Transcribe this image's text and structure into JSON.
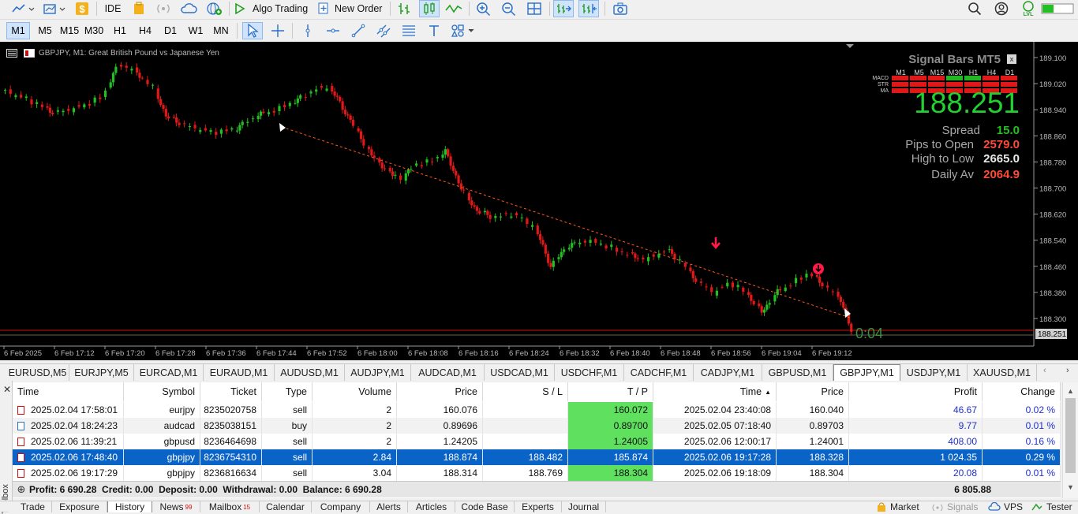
{
  "toolbar": {
    "ide": "IDE",
    "algo_trading": "Algo Trading",
    "new_order": "New Order",
    "timeframes": [
      "M1",
      "M5",
      "M15",
      "M30",
      "H1",
      "H4",
      "D1",
      "W1",
      "MN"
    ],
    "active_timeframe": "M1"
  },
  "chart": {
    "symbol_title": "GBPJPY, M1:  Great British Pound vs Japanese Yen",
    "timer": "0:04",
    "price_axis": [
      "189.100",
      "189.020",
      "188.940",
      "188.860",
      "188.780",
      "188.700",
      "188.620",
      "188.540",
      "188.460",
      "188.380",
      "188.300"
    ],
    "current_price_label": "188.251",
    "time_axis": [
      "6 Feb 2025",
      "6 Feb 17:12",
      "6 Feb 17:20",
      "6 Feb 17:28",
      "6 Feb 17:36",
      "6 Feb 17:44",
      "6 Feb 17:52",
      "6 Feb 18:00",
      "6 Feb 18:08",
      "6 Feb 18:16",
      "6 Feb 18:24",
      "6 Feb 18:32",
      "6 Feb 18:40",
      "6 Feb 18:48",
      "6 Feb 18:56",
      "6 Feb 19:04",
      "6 Feb 19:12"
    ],
    "colors": {
      "bull": "#22c022",
      "bear": "#e01818",
      "background": "#000000",
      "grid": "#1f1f1f"
    }
  },
  "signal_panel": {
    "title": "Signal Bars MT5",
    "close": "x",
    "timeframes": [
      "M1",
      "M5",
      "M15",
      "M30",
      "H1",
      "H4",
      "D1"
    ],
    "rows": [
      "MACD",
      "STR",
      "MA"
    ],
    "price": "188.251",
    "spread_label": "Spread",
    "spread_value": "15.0",
    "pips_label": "Pips to Open",
    "pips_value": "2579.0",
    "hl_label": "High to Low",
    "hl_value": "2665.0",
    "daily_label": "Daily Av",
    "daily_value": "2064.9"
  },
  "symbol_tabs": [
    "EURUSD,M5",
    "EURJPY,M5",
    "EURCAD,M1",
    "EURAUD,M1",
    "AUDUSD,M1",
    "AUDJPY,M1",
    "AUDCAD,M1",
    "USDCAD,M1",
    "USDCHF,M1",
    "CADCHF,M1",
    "CADJPY,M1",
    "GBPUSD,M1",
    "GBPJPY,M1",
    "USDJPY,M1",
    "XAUUSD,M1"
  ],
  "active_symbol_tab": "GBPJPY,M1",
  "history": {
    "columns": [
      "Time",
      "Symbol",
      "Ticket",
      "Type",
      "Volume",
      "Price",
      "S / L",
      "T / P",
      "Time",
      "Price",
      "Profit",
      "Change"
    ],
    "rows": [
      {
        "time": "2025.02.04 17:58:01",
        "symbol": "eurjpy",
        "ticket": "8235020758",
        "type": "sell",
        "volume": "2",
        "price": "160.076",
        "sl": "",
        "tp": "160.072",
        "time2": "2025.02.04 23:40:08",
        "price2": "160.040",
        "profit": "46.67",
        "change": "0.02 %"
      },
      {
        "time": "2025.02.04 18:24:23",
        "symbol": "audcad",
        "ticket": "8235038151",
        "type": "buy",
        "volume": "2",
        "price": "0.89696",
        "sl": "",
        "tp": "0.89700",
        "time2": "2025.02.05 07:18:40",
        "price2": "0.89703",
        "profit": "9.77",
        "change": "0.01 %"
      },
      {
        "time": "2025.02.06 11:39:21",
        "symbol": "gbpusd",
        "ticket": "8236464698",
        "type": "sell",
        "volume": "2",
        "price": "1.24205",
        "sl": "",
        "tp": "1.24005",
        "time2": "2025.02.06 12:00:17",
        "price2": "1.24001",
        "profit": "408.00",
        "change": "0.16 %"
      },
      {
        "time": "2025.02.06 17:48:40",
        "symbol": "gbpjpy",
        "ticket": "8236754310",
        "type": "sell",
        "volume": "2.84",
        "price": "188.874",
        "sl": "188.482",
        "tp": "185.874",
        "time2": "2025.02.06 19:17:28",
        "price2": "188.328",
        "profit": "1 024.35",
        "change": "0.29 %"
      },
      {
        "time": "2025.02.06 19:17:29",
        "symbol": "gbpjpy",
        "ticket": "8236816634",
        "type": "sell",
        "volume": "3.04",
        "price": "188.314",
        "sl": "188.769",
        "tp": "188.304",
        "time2": "2025.02.06 19:18:09",
        "price2": "188.304",
        "profit": "20.08",
        "change": "0.01 %"
      }
    ],
    "summary": "Profit: 6 690.28  Credit: 0.00  Deposit: 0.00  Withdrawal: 0.00  Balance: 6 690.28",
    "summary_total": "6 805.88"
  },
  "bottom_tabs": [
    "Trade",
    "Exposure",
    "History",
    "News",
    "Mailbox",
    "Calendar",
    "Company",
    "Alerts",
    "Articles",
    "Code Base",
    "Experts",
    "Journal"
  ],
  "news_badge": "99",
  "mailbox_badge": "15",
  "active_bottom_tab": "History",
  "right_tabs": [
    "Market",
    "Signals",
    "VPS",
    "Tester"
  ],
  "toolbox_label": "Toolbox"
}
